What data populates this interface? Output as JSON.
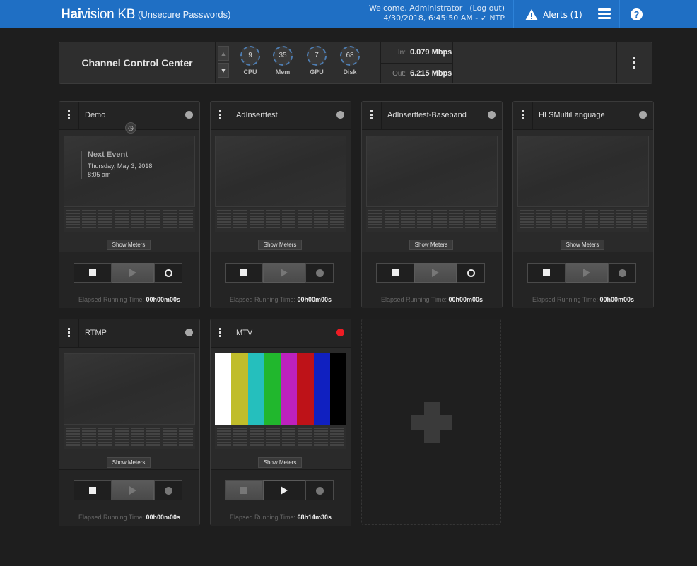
{
  "app": {
    "brand_bold": "Hai",
    "brand_rest": "vision KB",
    "warning": "(Unsecure Passwords)",
    "welcome": "Welcome, Administrator",
    "logout": "(Log out)",
    "datetime": "4/30/2018, 6:45:50 AM - ",
    "ntp": "✓ NTP",
    "alerts": "Alerts (1)",
    "help": "?"
  },
  "control_center": {
    "title": "Channel Control Center",
    "gauges": [
      {
        "value": "9",
        "label": "CPU"
      },
      {
        "value": "35",
        "label": "Mem"
      },
      {
        "value": "7",
        "label": "GPU"
      },
      {
        "value": "68",
        "label": "Disk"
      }
    ],
    "in_label": "In:",
    "in_value": "0.079 Mbps",
    "out_label": "Out:",
    "out_value": "6.215 Mbps"
  },
  "channels": [
    {
      "name": "Demo",
      "status": "idle",
      "next_event_title": "Next Event",
      "next_event_date": "Thursday, May 3, 2018",
      "next_event_time": "8:05 am",
      "show_meters": "Show Meters",
      "elapsed_label": "Elapsed Running Time:",
      "elapsed": "00h00m00s"
    },
    {
      "name": "AdInserttest",
      "status": "idle",
      "show_meters": "Show Meters",
      "elapsed_label": "Elapsed Running Time:",
      "elapsed": "00h00m00s"
    },
    {
      "name": "AdInserttest-Baseband",
      "status": "idle",
      "show_meters": "Show Meters",
      "elapsed_label": "Elapsed Running Time:",
      "elapsed": "00h00m00s"
    },
    {
      "name": "HLSMultiLanguage",
      "status": "idle",
      "show_meters": "Show Meters",
      "elapsed_label": "Elapsed Running Time:",
      "elapsed": "00h00m00s"
    },
    {
      "name": "RTMP",
      "status": "idle",
      "show_meters": "Show Meters",
      "elapsed_label": "Elapsed Running Time:",
      "elapsed": "00h00m00s"
    },
    {
      "name": "MTV",
      "status": "running",
      "show_meters": "Show Meters",
      "elapsed_label": "Elapsed Running Time:",
      "elapsed": "68h14m30s"
    }
  ],
  "colors": {
    "topbar": "#1f6fc4",
    "status_idle": "#a8a8a8",
    "status_running": "#ee1c24",
    "color_bars": [
      "#ffffff",
      "#c0bd2b",
      "#25bfbd",
      "#21b72d",
      "#bd21bd",
      "#be1218",
      "#1020c0",
      "#000000"
    ]
  }
}
